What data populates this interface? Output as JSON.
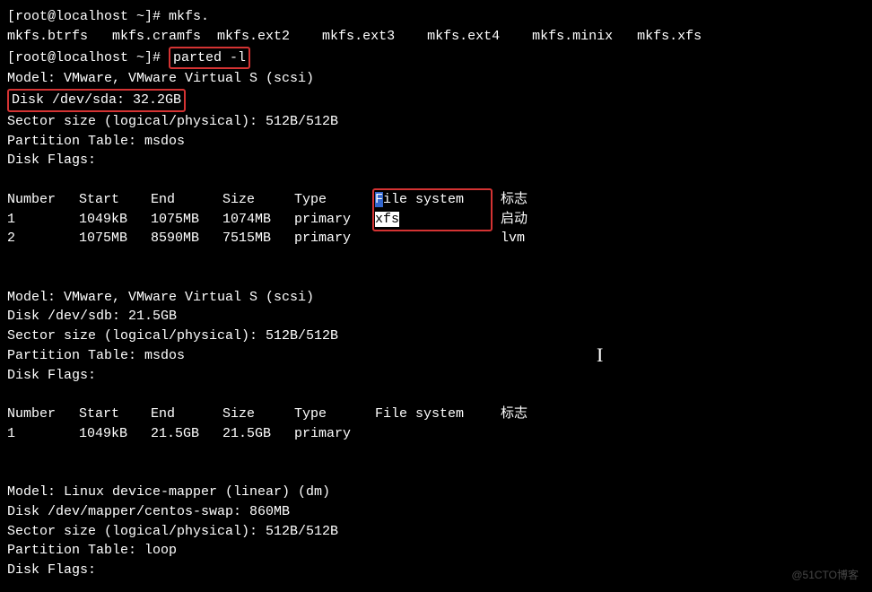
{
  "prompt1": {
    "text": "[root@localhost ~]# ",
    "cmd": "mkfs."
  },
  "mkfs_list": "mkfs.btrfs   mkfs.cramfs  mkfs.ext2    mkfs.ext3    mkfs.ext4    mkfs.minix   mkfs.xfs",
  "prompt2": {
    "text": "[root@localhost ~]# ",
    "cmd": "parted -l"
  },
  "disk1": {
    "model": "Model: VMware, VMware Virtual S (scsi)",
    "disk": "Disk /dev/sda: 32.2GB",
    "sector": "Sector size (logical/physical): 512B/512B",
    "ptable": "Partition Table: msdos",
    "flags": "Disk Flags:",
    "header": {
      "num": "Number",
      "start": "Start",
      "end": "End",
      "size": "Size",
      "type": "Type",
      "fs_f": "F",
      "fs_rest": "ile system",
      "flag": "标志"
    },
    "rows": [
      {
        "num": " 1",
        "start": "1049kB",
        "end": "1075MB",
        "size": "1074MB",
        "type": "primary",
        "fs": "xfs",
        "flag": "启动"
      },
      {
        "num": " 2",
        "start": "1075MB",
        "end": "8590MB",
        "size": "7515MB",
        "type": "primary",
        "fs": "",
        "flag": "lvm"
      }
    ]
  },
  "disk2": {
    "model": "Model: VMware, VMware Virtual S (scsi)",
    "disk": "Disk /dev/sdb: 21.5GB",
    "sector": "Sector size (logical/physical): 512B/512B",
    "ptable": "Partition Table: msdos",
    "flags": "Disk Flags:",
    "header": {
      "num": "Number",
      "start": "Start",
      "end": "End",
      "size": "Size",
      "type": "Type",
      "fs": "File system",
      "flag": "标志"
    },
    "rows": [
      {
        "num": " 1",
        "start": "1049kB",
        "end": "21.5GB",
        "size": "21.5GB",
        "type": "primary",
        "fs": "",
        "flag": ""
      }
    ]
  },
  "disk3": {
    "model": "Model: Linux device-mapper (linear) (dm)",
    "disk": "Disk /dev/mapper/centos-swap: 860MB",
    "sector": "Sector size (logical/physical): 512B/512B",
    "ptable": "Partition Table: loop",
    "flags": "Disk Flags:"
  },
  "watermark": "@51CTO博客"
}
